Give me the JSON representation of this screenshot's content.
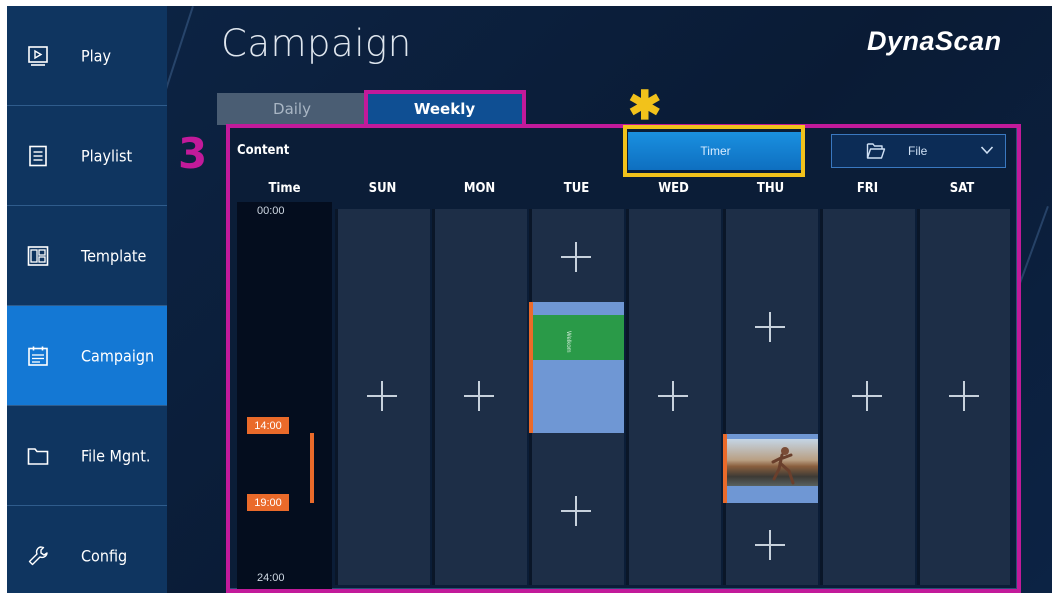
{
  "sidebar": {
    "items": [
      {
        "label": "Play",
        "icon": "play-screen-icon",
        "active": false
      },
      {
        "label": "Playlist",
        "icon": "list-document-icon",
        "active": false
      },
      {
        "label": "Template",
        "icon": "layout-template-icon",
        "active": false
      },
      {
        "label": "Campaign",
        "icon": "calendar-list-icon",
        "active": true
      },
      {
        "label": "File Mgnt.",
        "icon": "folder-icon",
        "active": false
      },
      {
        "label": "Config",
        "icon": "wrench-icon",
        "active": false
      }
    ]
  },
  "header": {
    "title": "Campaign",
    "brand": "DynaScan"
  },
  "tabs": [
    {
      "label": "Daily",
      "active": false
    },
    {
      "label": "Weekly",
      "active": true
    }
  ],
  "annotations": {
    "step_number": "3",
    "star_marker": "✱"
  },
  "toolbar": {
    "content_label": "Content",
    "timer_label": "Timer",
    "file_label": "File"
  },
  "schedule": {
    "time_header": "Time",
    "days": [
      "SUN",
      "MON",
      "TUE",
      "WED",
      "THU",
      "FRI",
      "SAT"
    ],
    "time_start": "00:00",
    "time_end": "24:00",
    "selection_start": "14:00",
    "selection_end": "19:00",
    "tue_block_label": "Welkom"
  },
  "colors": {
    "sidebar_bg": "#0f3560",
    "sidebar_active": "#1478d4",
    "annotation_magenta": "#c21a9a",
    "annotation_yellow": "#f2c21b",
    "time_tag": "#ea6a2a",
    "block_blue": "#6f97d4",
    "block_green": "#2a9a48"
  }
}
